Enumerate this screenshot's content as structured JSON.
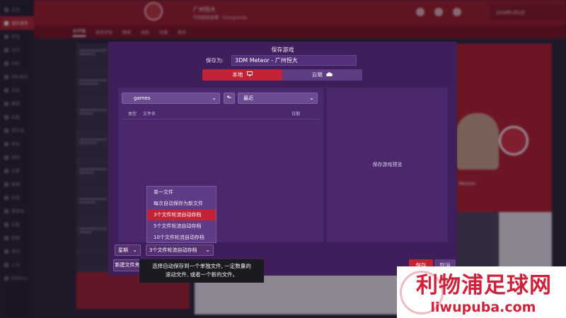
{
  "sidebar": {
    "items": [
      {
        "label": "主页",
        "active": false
      },
      {
        "label": "球队事务",
        "active": true
      },
      {
        "label": "阵容",
        "active": false
      },
      {
        "label": "战术",
        "active": false
      },
      {
        "label": "训练",
        "active": false
      },
      {
        "label": "球队报告",
        "active": false
      },
      {
        "label": "动态",
        "active": false
      },
      {
        "label": "赛程",
        "active": false
      },
      {
        "label": "比赛",
        "active": false
      },
      {
        "label": "俱乐部",
        "active": false
      },
      {
        "label": "转会",
        "active": false
      },
      {
        "label": "球探",
        "active": false
      },
      {
        "label": "比赛",
        "active": false
      },
      {
        "label": "数据",
        "active": false
      },
      {
        "label": "财务",
        "active": false
      },
      {
        "label": "董事会",
        "active": false
      },
      {
        "label": "设置",
        "active": false
      },
      {
        "label": "联赛",
        "active": false
      },
      {
        "label": "青训",
        "active": false
      },
      {
        "label": "人员",
        "active": false
      },
      {
        "label": "转会中心",
        "active": false
      }
    ]
  },
  "topbar": {
    "club_name": "广州恒大",
    "subtitle": "中国超级联赛 · Evergrande",
    "date": "2019年1月1日"
  },
  "nav_tabs": [
    "收件箱",
    "球员评估",
    "新闻",
    "动态",
    "社媒",
    "更多"
  ],
  "background_player": {
    "name": "Meteor"
  },
  "dialog": {
    "title": "保存游戏",
    "save_as_label": "保存为:",
    "save_as_value": "3DM Meteor - 广州恒大",
    "location_local": "本地",
    "location_cloud": "云端",
    "folder": "games",
    "sort": "最近",
    "col_type": "类型",
    "col_filename": "文件名",
    "col_date": "日期",
    "preview": "保存游戏预览",
    "period": "星期",
    "mode": "3个文件轮流自动存档",
    "new_folder": "新建文件夹",
    "save": "保存",
    "cancel": "取消",
    "tooltip_line1": "选择自动保存到一个单独文件, 一定数量的",
    "tooltip_line2": "滚动文件, 或者一个新的文件。",
    "autosave_options": [
      {
        "label": "单一文件",
        "selected": false
      },
      {
        "label": "每次自动保存为新文件",
        "selected": false
      },
      {
        "label": "3个文件轮流自动存档",
        "selected": true
      },
      {
        "label": "5个文件轮流自动存档",
        "selected": false
      },
      {
        "label": "10个文件轮流自动存档",
        "selected": false
      }
    ]
  },
  "watermark": {
    "title": "利物浦足球网",
    "url": "liwupuba.com"
  },
  "colors": {
    "accent_red": "#c42335",
    "dialog_purple": "#3f1e5c",
    "panel_purple": "#4a286b"
  }
}
